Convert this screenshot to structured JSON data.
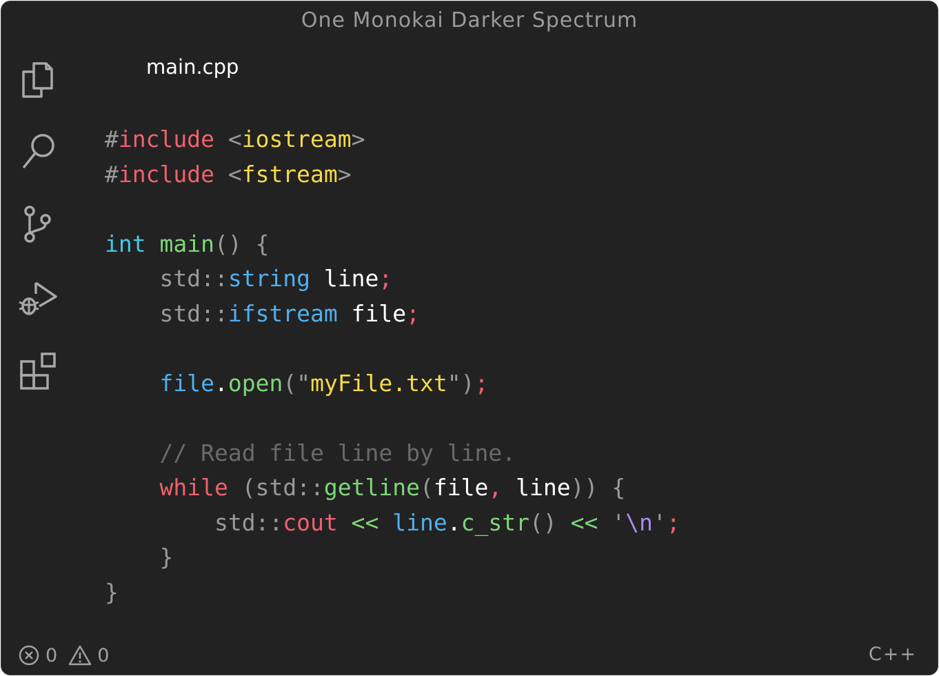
{
  "window": {
    "title": "One Monokai Darker Spectrum"
  },
  "activity_bar": {
    "items": [
      {
        "icon": "files-icon"
      },
      {
        "icon": "search-icon"
      },
      {
        "icon": "source-control-icon"
      },
      {
        "icon": "run-debug-icon"
      },
      {
        "icon": "extensions-icon"
      }
    ]
  },
  "editor": {
    "tab_label": "main.cpp",
    "lines": [
      [
        [
          "#",
          "#9a9a9a"
        ],
        [
          "include",
          "#f0616f"
        ],
        [
          " ",
          "#c8c8c8"
        ],
        [
          "<",
          "#9a9a9a"
        ],
        [
          "iostream",
          "#f8d94a"
        ],
        [
          ">",
          "#9a9a9a"
        ]
      ],
      [
        [
          "#",
          "#9a9a9a"
        ],
        [
          "include",
          "#f0616f"
        ],
        [
          " ",
          "#c8c8c8"
        ],
        [
          "<",
          "#9a9a9a"
        ],
        [
          "fstream",
          "#f8d94a"
        ],
        [
          ">",
          "#9a9a9a"
        ]
      ],
      [],
      [
        [
          "int",
          "#45c8e8"
        ],
        [
          " ",
          "#c8c8c8"
        ],
        [
          "main",
          "#7ed779"
        ],
        [
          "()",
          "#9a9a9a"
        ],
        [
          " ",
          "#c8c8c8"
        ],
        [
          "{",
          "#9a9a9a"
        ]
      ],
      [
        [
          "    ",
          "#c8c8c8"
        ],
        [
          "std::",
          "#9a9a9a"
        ],
        [
          "string",
          "#4fb0ef"
        ],
        [
          " ",
          "#c8c8c8"
        ],
        [
          "line",
          "#ffffff"
        ],
        [
          ";",
          "#f0616f"
        ]
      ],
      [
        [
          "    ",
          "#c8c8c8"
        ],
        [
          "std::",
          "#9a9a9a"
        ],
        [
          "ifstream",
          "#4fb0ef"
        ],
        [
          " ",
          "#c8c8c8"
        ],
        [
          "file",
          "#ffffff"
        ],
        [
          ";",
          "#f0616f"
        ]
      ],
      [],
      [
        [
          "    ",
          "#c8c8c8"
        ],
        [
          "file",
          "#4fb0ef"
        ],
        [
          ".",
          "#ffffff"
        ],
        [
          "open",
          "#7ed779"
        ],
        [
          "(",
          "#9a9a9a"
        ],
        [
          "\"",
          "#9a9a9a"
        ],
        [
          "myFile.txt",
          "#f8d94a"
        ],
        [
          "\"",
          "#9a9a9a"
        ],
        [
          ")",
          "#9a9a9a"
        ],
        [
          ";",
          "#f0616f"
        ]
      ],
      [],
      [
        [
          "    ",
          "#c8c8c8"
        ],
        [
          "// Read file line by line.",
          "#6a6a6a"
        ]
      ],
      [
        [
          "    ",
          "#c8c8c8"
        ],
        [
          "while",
          "#f0616f"
        ],
        [
          " ",
          "#c8c8c8"
        ],
        [
          "(",
          "#9a9a9a"
        ],
        [
          "std::",
          "#9a9a9a"
        ],
        [
          "getline",
          "#7ed779"
        ],
        [
          "(",
          "#9a9a9a"
        ],
        [
          "file",
          "#ffffff"
        ],
        [
          ",",
          "#f0616f"
        ],
        [
          " ",
          "#c8c8c8"
        ],
        [
          "line",
          "#ffffff"
        ],
        [
          "))",
          "#9a9a9a"
        ],
        [
          " ",
          "#c8c8c8"
        ],
        [
          "{",
          "#9a9a9a"
        ]
      ],
      [
        [
          "        ",
          "#c8c8c8"
        ],
        [
          "std::",
          "#9a9a9a"
        ],
        [
          "cout",
          "#f0616f"
        ],
        [
          " ",
          "#c8c8c8"
        ],
        [
          "<<",
          "#7ed779"
        ],
        [
          " ",
          "#c8c8c8"
        ],
        [
          "line",
          "#4fb0ef"
        ],
        [
          ".",
          "#ffffff"
        ],
        [
          "c_str",
          "#7ed779"
        ],
        [
          "()",
          "#9a9a9a"
        ],
        [
          " ",
          "#c8c8c8"
        ],
        [
          "<<",
          "#7ed779"
        ],
        [
          " ",
          "#c8c8c8"
        ],
        [
          "'",
          "#9a9a9a"
        ],
        [
          "\\n",
          "#a98af0"
        ],
        [
          "'",
          "#9a9a9a"
        ],
        [
          ";",
          "#f0616f"
        ]
      ],
      [
        [
          "    ",
          "#c8c8c8"
        ],
        [
          "}",
          "#9a9a9a"
        ]
      ],
      [
        [
          "}",
          "#9a9a9a"
        ]
      ]
    ]
  },
  "status_bar": {
    "errors_icon": "error-circle-icon",
    "errors": "0",
    "warnings_icon": "warning-triangle-icon",
    "warnings": "0",
    "language": "C++"
  },
  "colors": {
    "background": "#222222",
    "icon": "#a8a8a8"
  }
}
